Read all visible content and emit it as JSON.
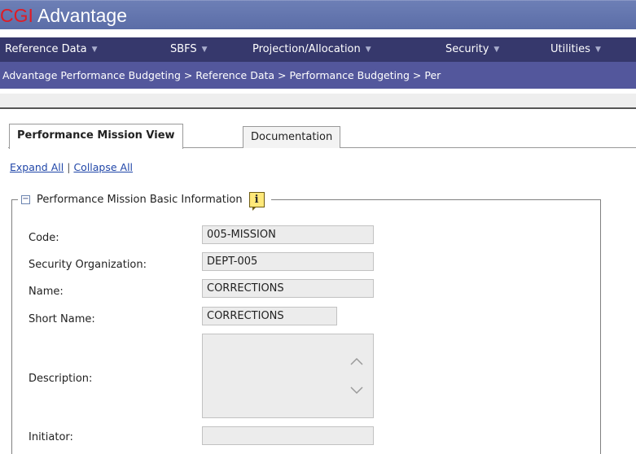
{
  "app": {
    "logo_brand": "CGI",
    "logo_name": "Advantage"
  },
  "menu": {
    "items": [
      {
        "label": "Reference Data"
      },
      {
        "label": "SBFS"
      },
      {
        "label": "Projection/Allocation"
      },
      {
        "label": "Security"
      },
      {
        "label": "Utilities"
      }
    ]
  },
  "breadcrumb": {
    "text": "Advantage Performance Budgeting > Reference Data > Performance Budgeting > Per"
  },
  "tabs": [
    {
      "label": "Performance Mission View",
      "active": true
    },
    {
      "label": "Documentation",
      "active": false
    }
  ],
  "links": {
    "expand_all": "Expand All",
    "separator": "|",
    "collapse_all": "Collapse All"
  },
  "section": {
    "toggle_symbol": "−",
    "title": "Performance Mission Basic Information",
    "info_symbol": "i"
  },
  "form": {
    "code": {
      "label": "Code:",
      "value": "005-MISSION"
    },
    "security_org": {
      "label": "Security Organization:",
      "value": "DEPT-005"
    },
    "name": {
      "label": "Name:",
      "value": "CORRECTIONS"
    },
    "short_name": {
      "label": "Short Name:",
      "value": "CORRECTIONS"
    },
    "description": {
      "label": "Description:",
      "value": ""
    },
    "initiator": {
      "label": "Initiator:",
      "value": ""
    }
  },
  "colors": {
    "titlebar": "#6070ad",
    "menubar": "#36386c",
    "breadcrumb": "#53579c",
    "brand_red": "#e01b24",
    "link_blue": "#2046a8"
  },
  "icons": {
    "menu_caret": "chevron-down-icon",
    "section_toggle": "collapse-icon",
    "section_info": "info-icon"
  }
}
